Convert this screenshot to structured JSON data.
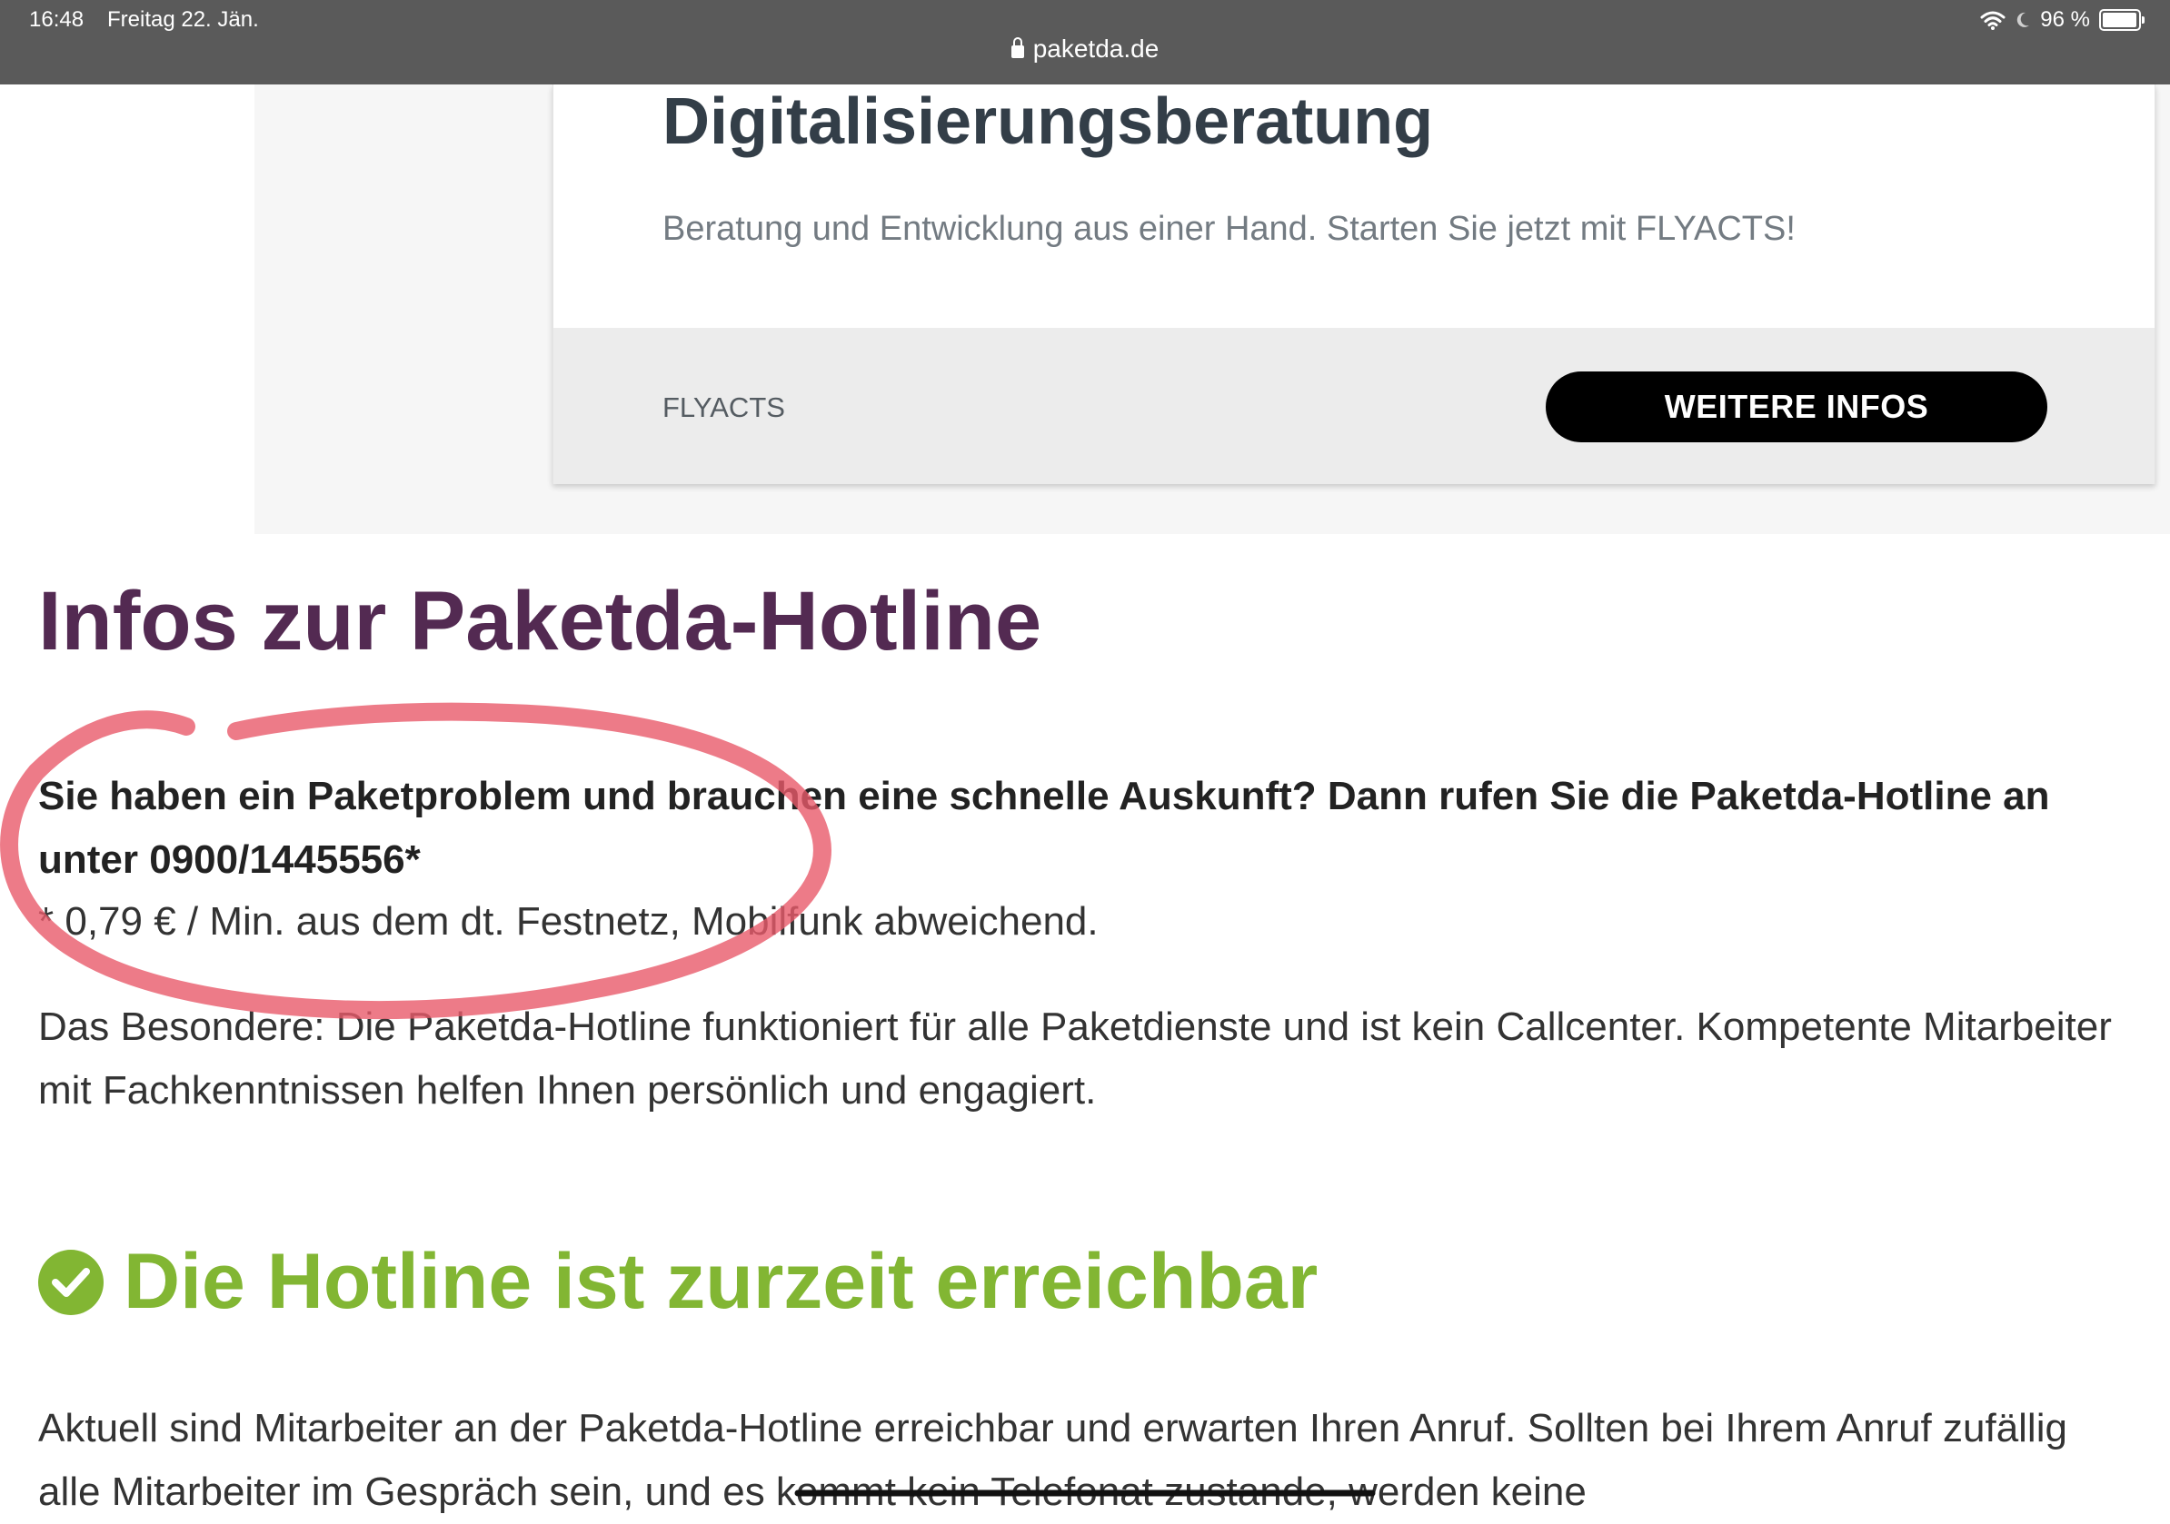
{
  "status_bar": {
    "time": "16:48",
    "date": "Freitag 22. Jän.",
    "url": "paketda.de",
    "battery": "96 %"
  },
  "ad": {
    "title": "Digitalisierungsberatung",
    "description": "Beratung und Entwicklung aus einer Hand. Starten Sie jetzt mit FLYACTS!",
    "brand": "FLYACTS",
    "button_label": "WEITERE INFOS"
  },
  "content": {
    "title": "Infos zur Paketda-Hotline",
    "lead": "Sie haben ein Paketproblem und brauchen eine schnelle Auskunft? Dann rufen Sie die Paketda-Hotline an unter 0900/1445556*",
    "note": "* 0,79 € / Min. aus dem dt. Festnetz, Mobilfunk abweichend.",
    "special": "Das Besondere: Die Paketda-Hotline funktioniert für alle Paketdienste und ist kein Callcenter. Kompetente Mitarbeiter mit Fachkenntnissen helfen Ihnen persönlich und engagiert.",
    "status_heading": "Die Hotline ist zurzeit erreichbar",
    "current": "Aktuell sind Mitarbeiter an der Paketda-Hotline erreichbar und erwarten Ihren Anruf. Sollten bei Ihrem Anruf zufällig alle Mitarbeiter im Gespräch sein, und es kommt kein Telefonat zustande, werden keine"
  },
  "colors": {
    "status_bar": "#5a5a5a",
    "title_purple": "#532a52",
    "status_green": "#82b633",
    "annotation_red": "#e85a6a"
  },
  "icons": {
    "lock": "lock-icon",
    "wifi": "wifi-icon",
    "moon": "moon-icon",
    "battery": "battery-icon",
    "check": "check-circle-icon"
  }
}
